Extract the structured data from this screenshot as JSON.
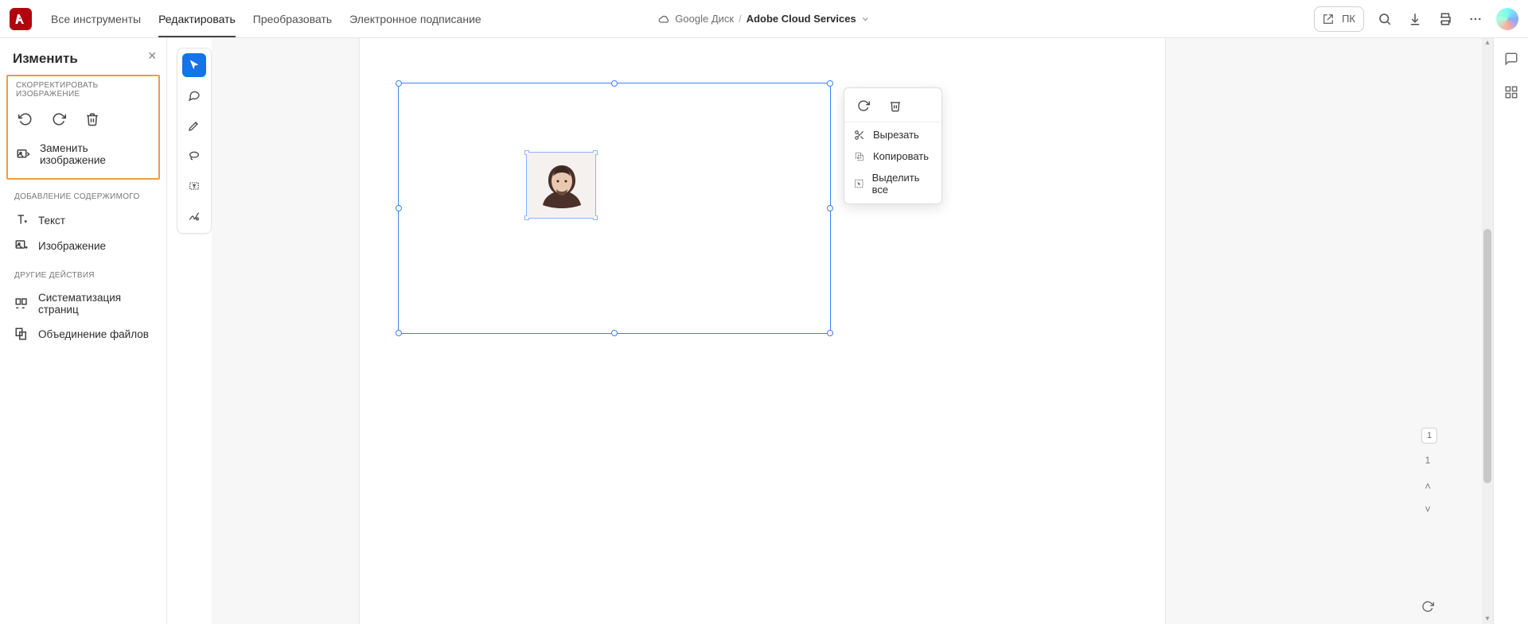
{
  "topnav": {
    "items": [
      "Все инструменты",
      "Редактировать",
      "Преобразовать",
      "Электронное подписание"
    ],
    "active_index": 1
  },
  "location": {
    "drive": "Google Диск",
    "separator": "/",
    "file": "Adobe Cloud Services"
  },
  "top_right": {
    "open_external_label": "ПК"
  },
  "left_panel": {
    "title": "Изменить",
    "section_adjust": "СКОРРЕКТИРОВАТЬ ИЗОБРАЖЕНИЕ",
    "replace_image": "Заменить изображение",
    "section_add": "ДОБАВЛЕНИЕ СОДЕРЖИМОГО",
    "add_text": "Текст",
    "add_image": "Изображение",
    "section_other": "ДРУГИЕ ДЕЙСТВИЯ",
    "organize_pages": "Систематизация страниц",
    "combine_files": "Объединение файлов"
  },
  "context_menu": {
    "cut": "Вырезать",
    "copy": "Копировать",
    "select_all": "Выделить все"
  },
  "pagination": {
    "bubble": "1",
    "current": "1"
  }
}
